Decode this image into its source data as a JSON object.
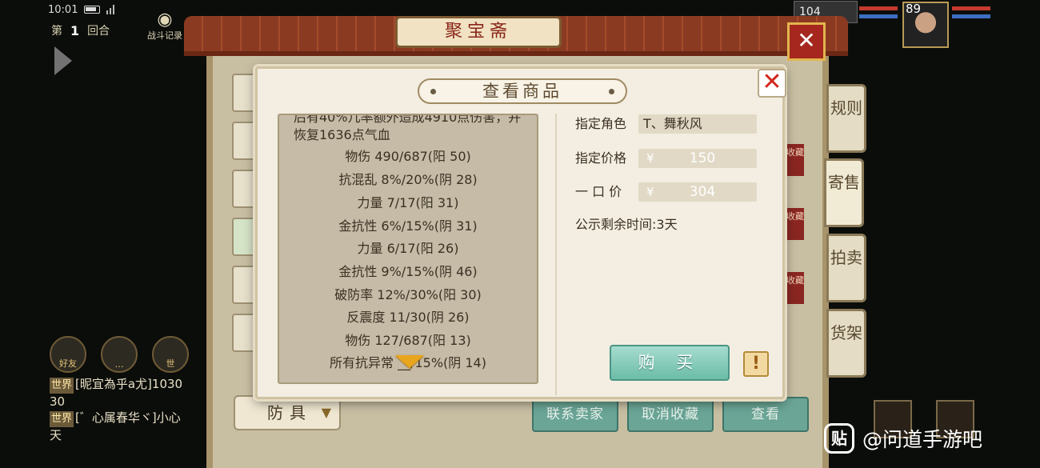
{
  "status_bar": {
    "time": "10:01"
  },
  "hud": {
    "round_prefix": "第",
    "round_number": "1",
    "round_suffix": "回合",
    "battle_record": "战斗记录",
    "top_level_left": "104",
    "top_level_right": "89"
  },
  "social": {
    "friend_label": "好友",
    "mic_label": "世"
  },
  "chat": {
    "lines": [
      {
        "tag": "世界",
        "text": "[昵宜為乎a尤]1030"
      },
      {
        "tag": "",
        "text": "30"
      },
      {
        "tag": "世界",
        "text": "[゛心属春华ヾ]小心"
      },
      {
        "tag": "",
        "text": "天"
      }
    ]
  },
  "shop": {
    "title": "聚宝斋",
    "category_select": "防具",
    "buttons": {
      "contact_seller": "联系卖家",
      "cancel_favorite": "取消收藏",
      "view": "查看"
    },
    "favorite_tag": "收藏",
    "tabs": [
      {
        "label": "规则"
      },
      {
        "label": "寄售"
      },
      {
        "label": "拍卖"
      },
      {
        "label": "货架"
      }
    ]
  },
  "dialog": {
    "title": "查看商品",
    "description": "后有40%几率额外造成4910点伤害，并恢复1636点气血",
    "stats": [
      "物伤 490/687(阳 50)",
      "抗混乱 8%/20%(阴 28)",
      "力量 7/17(阳 31)",
      "金抗性 6%/15%(阴 31)",
      "力量 6/17(阳 26)",
      "金抗性 9%/15%(阴 46)",
      "破防率 12%/30%(阳 30)",
      "反震度 11/30(阴 26)",
      "物伤 127/687(阳 13)",
      "所有抗异常 __/15%(阴 14)"
    ],
    "designated_role_label": "指定角色",
    "designated_role_value": "T、舞秋风",
    "designated_price_label": "指定价格",
    "designated_price_value": "150",
    "buyout_label": "一 口 价",
    "buyout_value": "304",
    "currency_symbol": "¥",
    "remaining_time": "公示剩余时间:3天",
    "buy_button": "购 买",
    "warn_button": "!"
  },
  "watermark": "@问道手游吧",
  "colors": {
    "accent_green": "#6bbca8",
    "close_red": "#d1261c",
    "panel_bg": "#f3eee1",
    "stats_bg": "#c5bba7"
  }
}
